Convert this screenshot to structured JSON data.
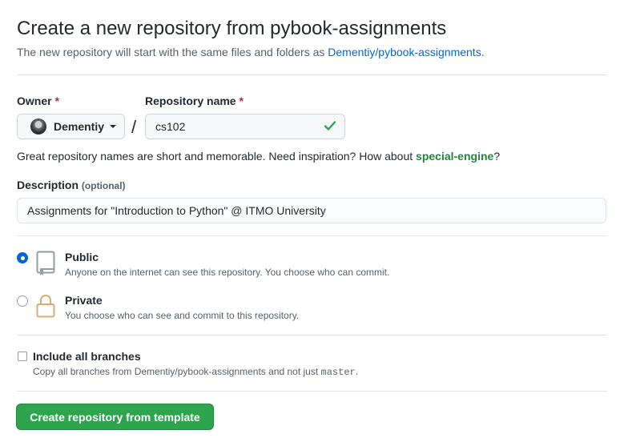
{
  "header": {
    "title": "Create a new repository from pybook-assignments",
    "subtitle_prefix": "The new repository will start with the same files and folders as ",
    "template_link": "Dementiy/pybook-assignments",
    "subtitle_suffix": "."
  },
  "owner": {
    "label": "Owner",
    "required_mark": "*",
    "selected": "Dementiy",
    "caret_icon": "caret-down-icon"
  },
  "separator": "/",
  "repo_name": {
    "label": "Repository name",
    "required_mark": "*",
    "value": "cs102",
    "valid_icon": "check-icon",
    "valid_color": "#28a745"
  },
  "hint": {
    "prefix": "Great repository names are short and memorable. Need inspiration? How about ",
    "suggestion": "special-engine",
    "suffix": "?"
  },
  "description": {
    "label": "Description",
    "optional": "(optional)",
    "value": "Assignments for \"Introduction to Python\" @ ITMO University"
  },
  "visibility": {
    "options": [
      {
        "title": "Public",
        "desc": "Anyone on the internet can see this repository. You choose who can commit.",
        "selected": true,
        "icon": "repo-icon"
      },
      {
        "title": "Private",
        "desc": "You choose who can see and commit to this repository.",
        "selected": false,
        "icon": "lock-icon"
      }
    ]
  },
  "branches": {
    "label": "Include all branches",
    "desc_prefix": "Copy all branches from Dementiy/pybook-assignments and not just ",
    "branch": "master",
    "desc_suffix": ".",
    "checked": false
  },
  "submit": {
    "label": "Create repository from template",
    "color": "#2ea44f"
  }
}
